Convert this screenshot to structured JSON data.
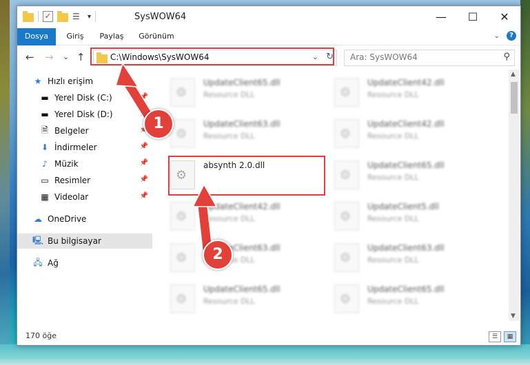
{
  "window": {
    "title": "SysWOW64",
    "controls": {
      "minimize": "—",
      "maximize": "☐",
      "close": "✕"
    }
  },
  "ribbon": {
    "tabs": [
      "Dosya",
      "Giriş",
      "Paylaş",
      "Görünüm"
    ],
    "help": "?"
  },
  "nav": {
    "back": "←",
    "forward": "→",
    "recent": "⌄",
    "up": "↑",
    "address": "C:\\Windows\\SysWOW64",
    "search_placeholder": "Ara: SysWOW64"
  },
  "sidebar": {
    "items": [
      {
        "label": "Hızlı erişim",
        "icon": "star-icon"
      },
      {
        "label": "Yerel Disk (C:)",
        "icon": "drive-icon",
        "pinned": true
      },
      {
        "label": "Yerel Disk (D:)",
        "icon": "drive-icon",
        "pinned": true
      },
      {
        "label": "Belgeler",
        "icon": "documents-icon",
        "pinned": true
      },
      {
        "label": "İndirmeler",
        "icon": "download-icon",
        "pinned": true
      },
      {
        "label": "Müzik",
        "icon": "music-icon",
        "pinned": true
      },
      {
        "label": "Resimler",
        "icon": "pictures-icon",
        "pinned": true
      },
      {
        "label": "Videolar",
        "icon": "videos-icon",
        "pinned": true
      },
      {
        "label": "OneDrive",
        "icon": "cloud-icon"
      },
      {
        "label": "Bu bilgisayar",
        "icon": "computer-icon",
        "selected": true
      },
      {
        "label": "Ağ",
        "icon": "network-icon"
      }
    ]
  },
  "files": {
    "left": [
      {
        "name": "UpdateClient65.dll",
        "type": "Resource DLL"
      },
      {
        "name": "UpdateClient63.dll",
        "type": "Resource DLL"
      },
      {
        "name": "absynth 2.0.dll",
        "type": ""
      },
      {
        "name": "UpdateClient42.dll",
        "type": "Resource DLL"
      },
      {
        "name": "UpdateClient63.dll",
        "type": "Resource DLL"
      },
      {
        "name": "UpdateClient65.dll",
        "type": "Resource DLL"
      }
    ],
    "right": [
      {
        "name": "UpdateClient42.dll",
        "type": "Resource DLL"
      },
      {
        "name": "UpdateClient42.dll",
        "type": "Resource DLL"
      },
      {
        "name": "UpdateClient65.dll",
        "type": "Resource DLL"
      },
      {
        "name": "UpdateClient5.dll",
        "type": "Resource DLL"
      },
      {
        "name": "UpdateClient63.dll",
        "type": "Resource DLL"
      },
      {
        "name": "UpdateClient65.dll",
        "type": "Resource DLL"
      }
    ]
  },
  "status": {
    "count": "170 öğe"
  },
  "annotations": {
    "step1": "1",
    "step2": "2",
    "accent": "#e4403a"
  }
}
